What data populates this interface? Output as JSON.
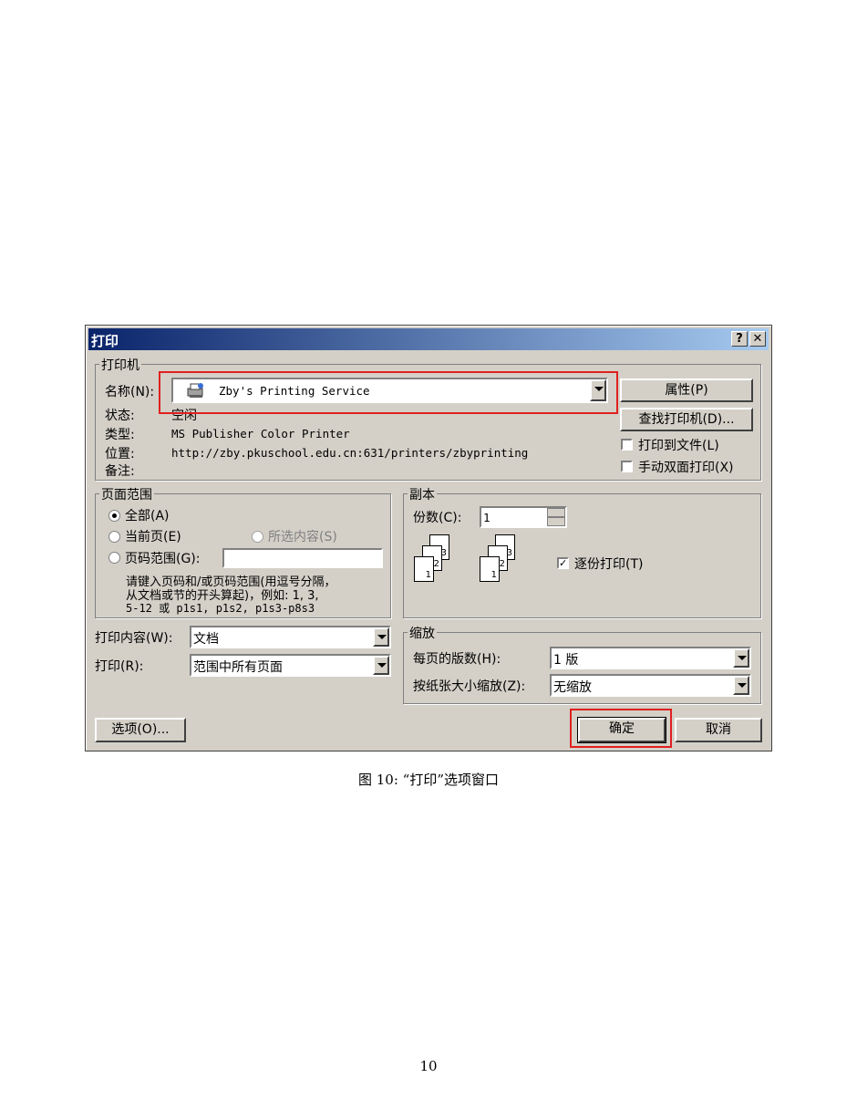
{
  "dialog": {
    "title": "打印",
    "help_label": "?",
    "close_label": "✕",
    "printer_group": {
      "legend": "打印机",
      "name_label": "名称(N):",
      "name_value": "Zby's Printing Service",
      "status_label": "状态:",
      "status_value": "空闲",
      "type_label": "类型:",
      "type_value": "MS Publisher Color Printer",
      "location_label": "位置:",
      "location_value": "http://zby.pkuschool.edu.cn:631/printers/zbyprinting",
      "comment_label": "备注:",
      "properties_button": "属性(P)",
      "find_printer_button": "查找打印机(D)...",
      "print_to_file_label": "打印到文件(L)",
      "manual_duplex_label": "手动双面打印(X)"
    },
    "range_group": {
      "legend": "页面范围",
      "all_label": "全部(A)",
      "current_page_label": "当前页(E)",
      "selection_label": "所选内容(S)",
      "pages_label": "页码范围(G):",
      "pages_value": "",
      "hint_line1": "请键入页码和/或页码范围(用逗号分隔，",
      "hint_line2": "从文档或节的开头算起)，例如: 1, 3,",
      "hint_line3": "5-12 或 p1s1, p1s2, p1s3-p8s3"
    },
    "copies_group": {
      "legend": "副本",
      "copies_label": "份数(C):",
      "copies_value": "1",
      "collate_label": "逐份打印(T)",
      "page_numbers": [
        "1",
        "2",
        "3"
      ]
    },
    "print_what_label": "打印内容(W):",
    "print_what_value": "文档",
    "print_label": "打印(R):",
    "print_value": "范围中所有页面",
    "zoom_group": {
      "legend": "缩放",
      "pages_per_sheet_label": "每页的版数(H):",
      "pages_per_sheet_value": "1 版",
      "scale_label": "按纸张大小缩放(Z):",
      "scale_value": "无缩放"
    },
    "options_button": "选项(O)...",
    "ok_button": "确定",
    "cancel_button": "取消"
  },
  "caption": "图 10: “打印”选项窗口",
  "page_number": "10"
}
